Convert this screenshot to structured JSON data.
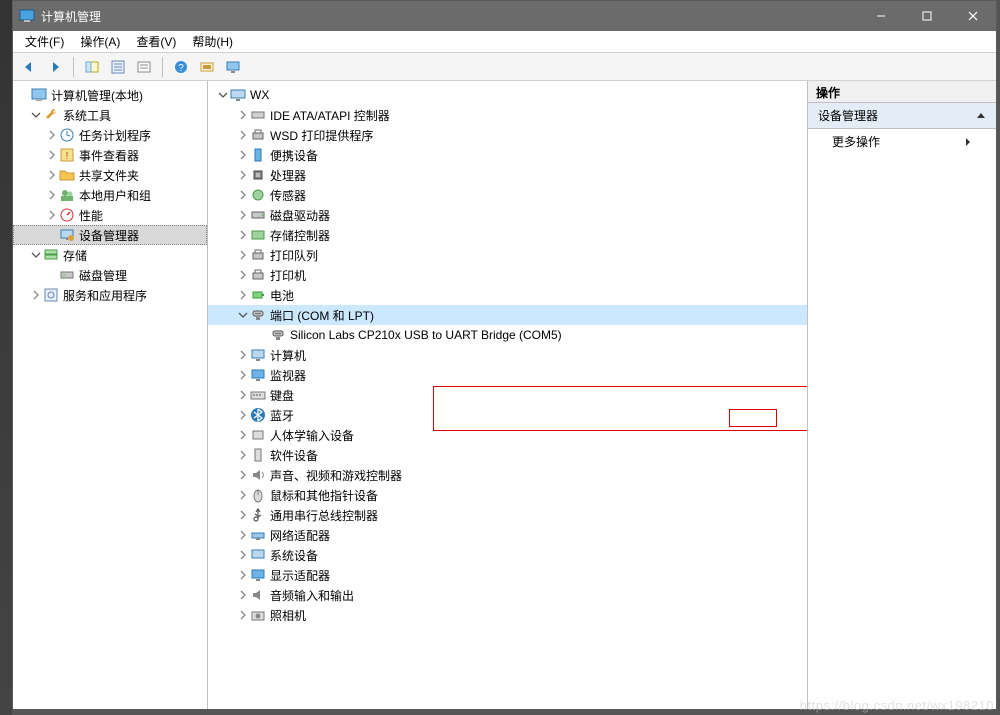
{
  "window": {
    "title": "计算机管理"
  },
  "menubar": {
    "file": "文件(F)",
    "action": "操作(A)",
    "view": "查看(V)",
    "help": "帮助(H)"
  },
  "left_tree": {
    "root": "计算机管理(本地)",
    "system_tools": "系统工具",
    "task_scheduler": "任务计划程序",
    "event_viewer": "事件查看器",
    "shared_folders": "共享文件夹",
    "local_users": "本地用户和组",
    "performance": "性能",
    "device_manager": "设备管理器",
    "storage": "存储",
    "disk_management": "磁盘管理",
    "services": "服务和应用程序"
  },
  "device_tree": {
    "root": "WX",
    "ide": "IDE ATA/ATAPI 控制器",
    "wsd": "WSD 打印提供程序",
    "portable": "便携设备",
    "cpu": "处理器",
    "sensors": "传感器",
    "disk_drives": "磁盘驱动器",
    "storage_ctrl": "存储控制器",
    "print_queues": "打印队列",
    "printers": "打印机",
    "battery": "电池",
    "ports": "端口 (COM 和 LPT)",
    "port_device": "Silicon Labs CP210x USB to UART Bridge (COM5)",
    "computer": "计算机",
    "monitors": "监视器",
    "keyboards": "键盘",
    "bluetooth": "蓝牙",
    "hid": "人体学输入设备",
    "software": "软件设备",
    "sound": "声音、视频和游戏控制器",
    "mice": "鼠标和其他指针设备",
    "usb_serial": "通用串行总线控制器",
    "network": "网络适配器",
    "system_devices": "系统设备",
    "display": "显示适配器",
    "audio_io": "音频输入和输出",
    "cameras": "照相机"
  },
  "actions_pane": {
    "header": "操作",
    "section": "设备管理器",
    "more": "更多操作"
  },
  "watermark": "https://blog.csdn.net/wx198210"
}
